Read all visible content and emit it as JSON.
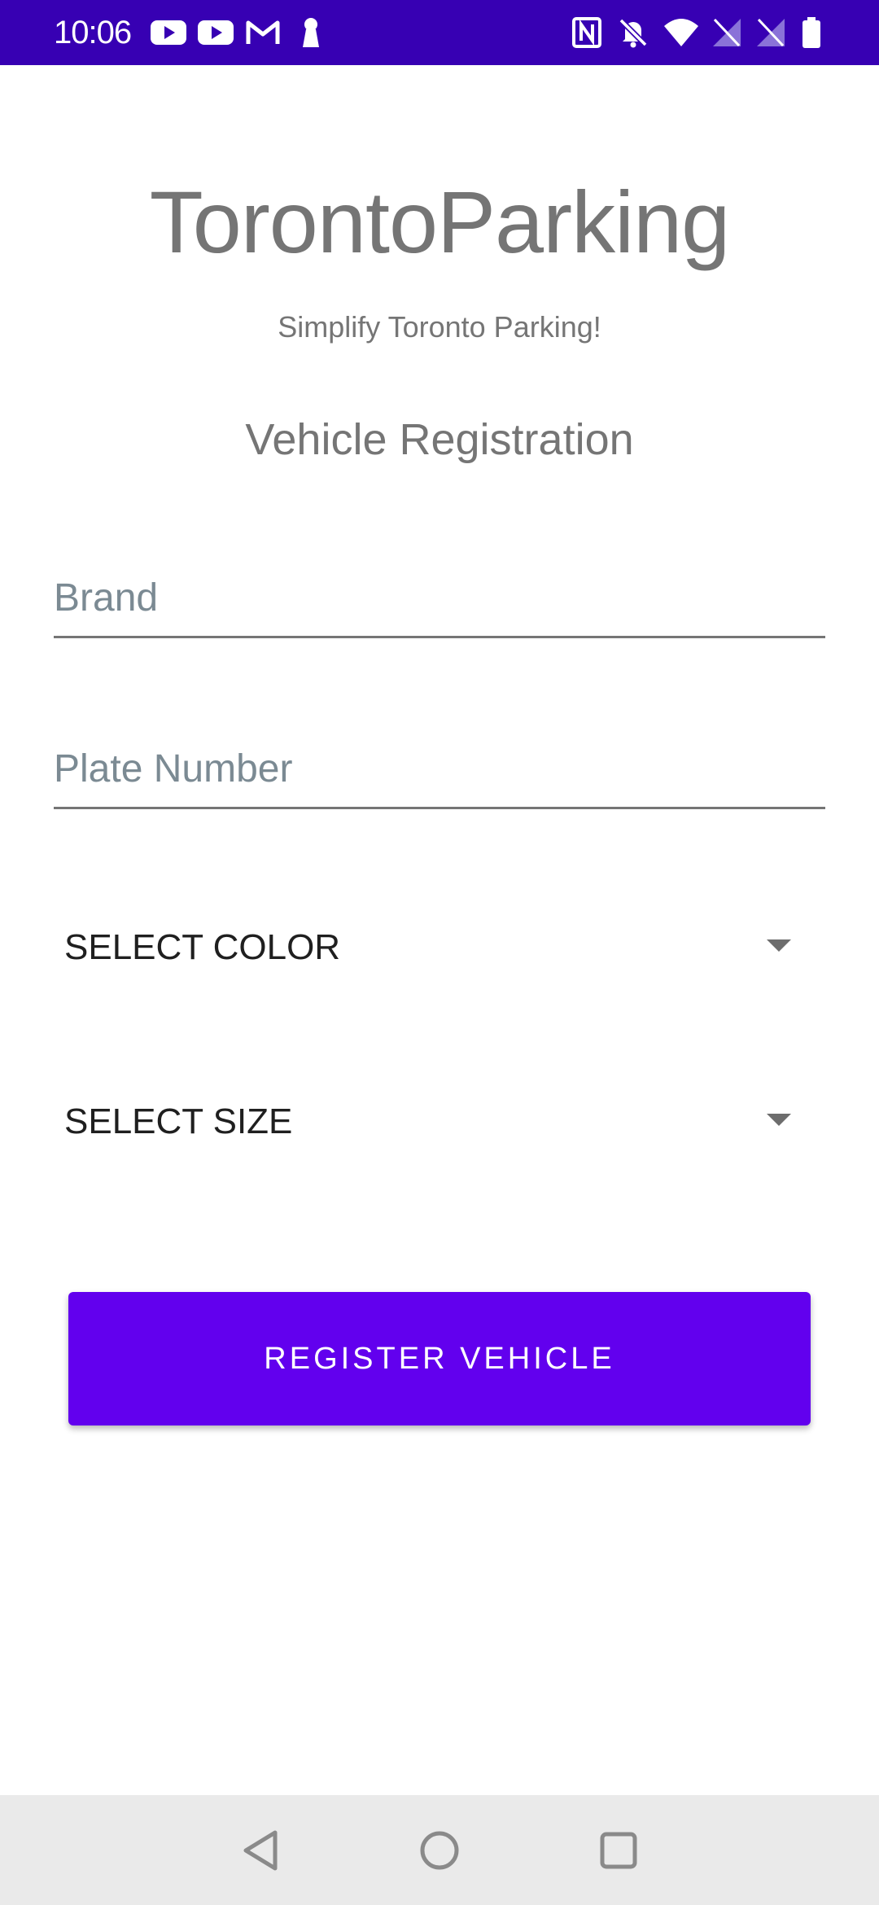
{
  "status_bar": {
    "time": "10:06",
    "left_icons": [
      "youtube-icon",
      "youtube-icon",
      "gmail-icon",
      "keyhole-icon"
    ],
    "right_icons": [
      "nfc-icon",
      "notifications-off-icon",
      "wifi-icon",
      "no-sim-icon",
      "no-sim-icon",
      "battery-icon"
    ],
    "background_color": "#3700b3"
  },
  "header": {
    "title": "TorontoParking",
    "subtitle": "Simplify Toronto Parking!",
    "section_title": "Vehicle Registration"
  },
  "form": {
    "brand_placeholder": "Brand",
    "brand_value": "",
    "plate_placeholder": "Plate Number",
    "plate_value": "",
    "color_spinner_label": "SELECT COLOR",
    "size_spinner_label": "SELECT SIZE",
    "register_label": "REGISTER VEHICLE",
    "accent_color": "#6200ee"
  },
  "nav_bar": {
    "buttons": [
      "back-icon",
      "home-icon",
      "recents-icon"
    ]
  }
}
